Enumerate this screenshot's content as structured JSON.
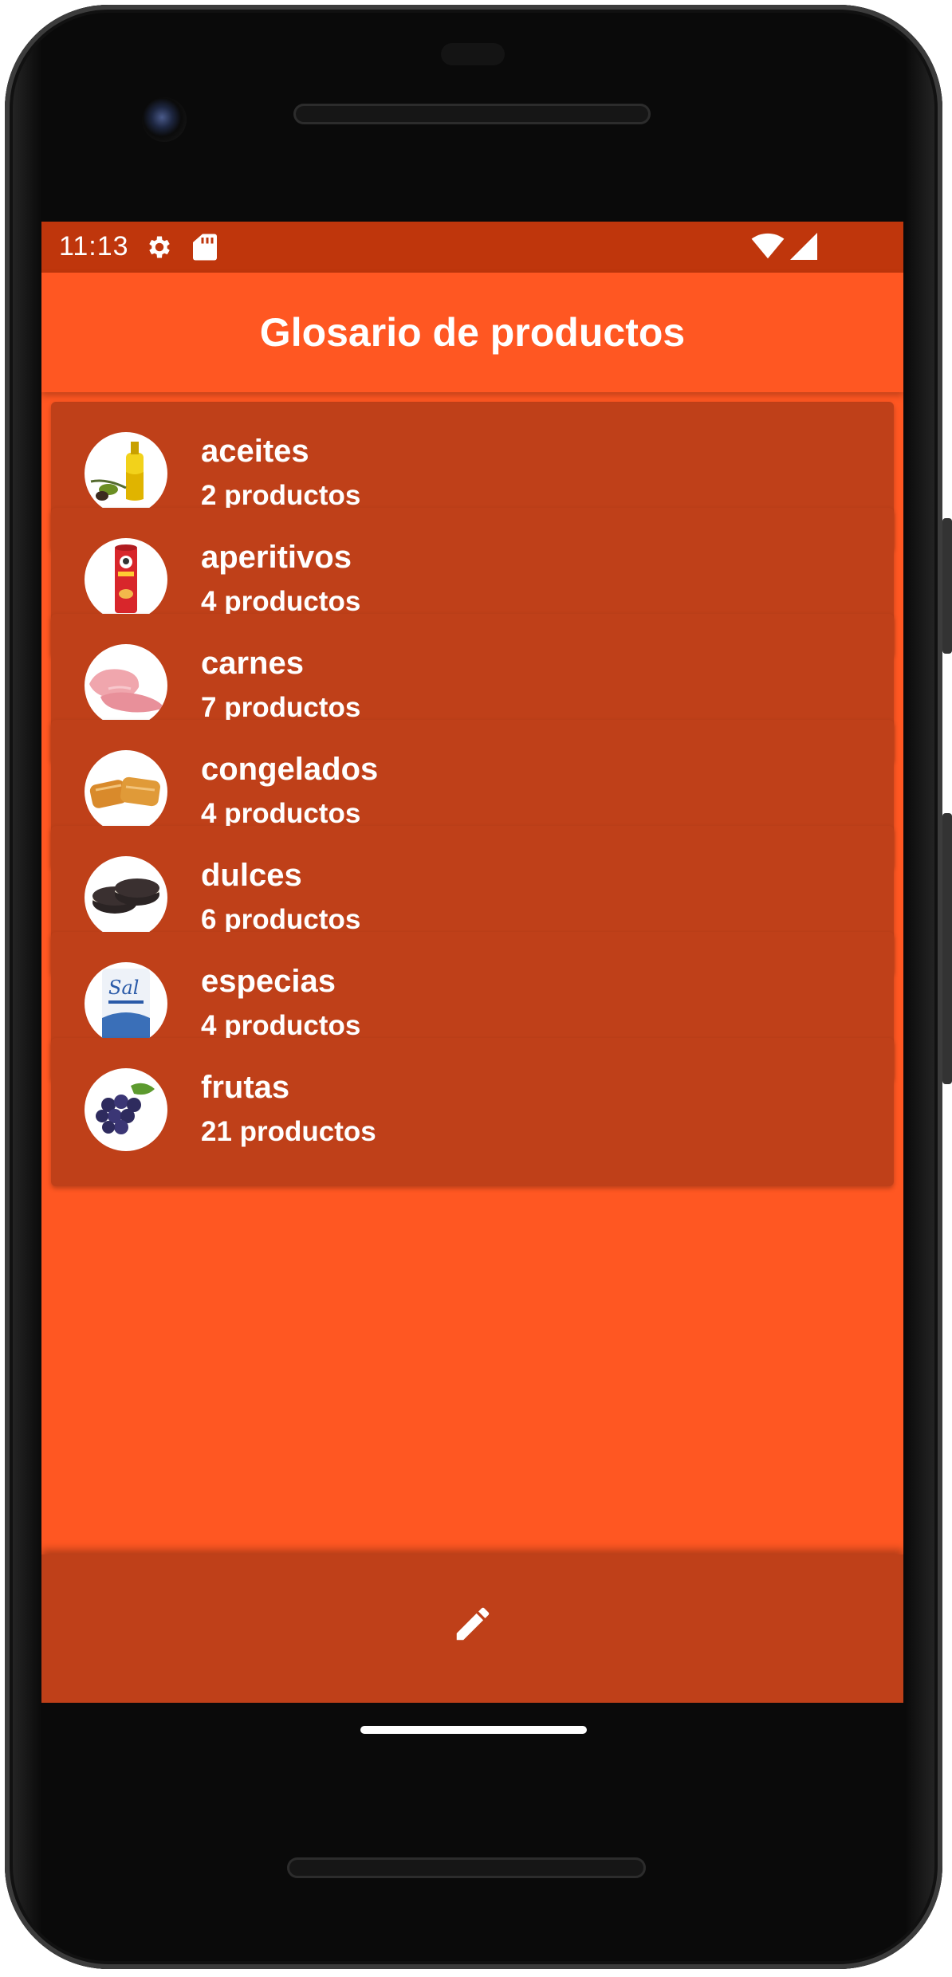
{
  "status_bar": {
    "time": "11:13",
    "icons": [
      "gear-icon",
      "sd-card-icon",
      "wifi-icon",
      "signal-icon"
    ]
  },
  "app_bar": {
    "title": "Glosario de productos"
  },
  "categories": [
    {
      "name": "aceites",
      "count": "2 productos",
      "image": "olive-oil-image"
    },
    {
      "name": "aperitivos",
      "count": "4 productos",
      "image": "chips-can-image"
    },
    {
      "name": "carnes",
      "count": "7 productos",
      "image": "ham-slices-image"
    },
    {
      "name": "congelados",
      "count": "4 productos",
      "image": "frozen-pastry-image"
    },
    {
      "name": "dulces",
      "count": "6 productos",
      "image": "cookies-image"
    },
    {
      "name": "especias",
      "count": "4 productos",
      "image": "salt-package-image"
    },
    {
      "name": "frutas",
      "count": "21 productos",
      "image": "grapes-image"
    }
  ],
  "bottom_bar": {
    "action_icon": "edit-icon"
  },
  "colors": {
    "primary": "#ff5722",
    "primary_dark": "#bf360c",
    "card": "#bf4019",
    "text": "#ffffff"
  }
}
